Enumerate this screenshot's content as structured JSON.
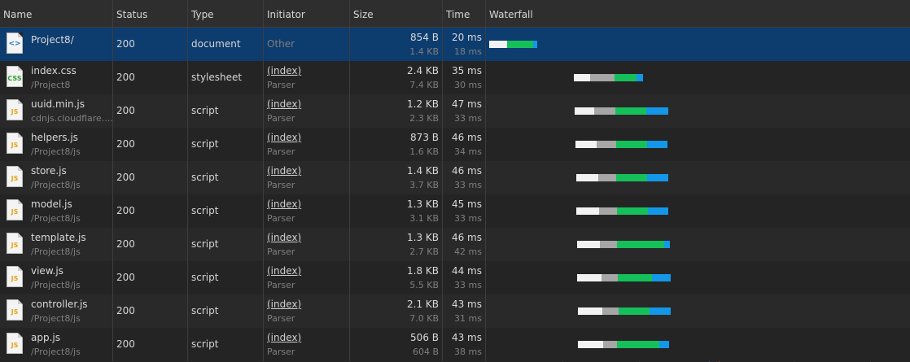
{
  "columns": {
    "name": "Name",
    "status": "Status",
    "type": "Type",
    "initiator": "Initiator",
    "size": "Size",
    "time": "Time",
    "waterfall": "Waterfall"
  },
  "colors": {
    "selected_row": "#0d3c6e",
    "queueing": "#f2f2f2",
    "stalled": "#a6a6a6",
    "waiting": "#15c05a",
    "download": "#1497e8",
    "dom_content_loaded_line": "#1f5fb8",
    "load_line": "#b3262b"
  },
  "rows": [
    {
      "name": "Project8/",
      "path": "",
      "icon": "document-icon",
      "status": "200",
      "type": "document",
      "initiator": "Other",
      "initiator_sub": "",
      "size": "854 B",
      "size_sub": "1.4 KB",
      "time": "20 ms",
      "time_sub": "18 ms",
      "selected": true
    },
    {
      "name": "index.css",
      "path": "/Project8",
      "icon": "css-file-icon",
      "status": "200",
      "type": "stylesheet",
      "initiator": "(index)",
      "initiator_sub": "Parser",
      "size": "2.4 KB",
      "size_sub": "7.4 KB",
      "time": "35 ms",
      "time_sub": "30 ms",
      "selected": false
    },
    {
      "name": "uuid.min.js",
      "path": "cdnjs.cloudflare....",
      "icon": "js-file-icon",
      "status": "200",
      "type": "script",
      "initiator": "(index)",
      "initiator_sub": "Parser",
      "size": "1.2 KB",
      "size_sub": "2.3 KB",
      "time": "47 ms",
      "time_sub": "33 ms",
      "selected": false
    },
    {
      "name": "helpers.js",
      "path": "/Project8/js",
      "icon": "js-file-icon",
      "status": "200",
      "type": "script",
      "initiator": "(index)",
      "initiator_sub": "Parser",
      "size": "873 B",
      "size_sub": "1.6 KB",
      "time": "46 ms",
      "time_sub": "34 ms",
      "selected": false
    },
    {
      "name": "store.js",
      "path": "/Project8/js",
      "icon": "js-file-icon",
      "status": "200",
      "type": "script",
      "initiator": "(index)",
      "initiator_sub": "Parser",
      "size": "1.4 KB",
      "size_sub": "3.7 KB",
      "time": "46 ms",
      "time_sub": "33 ms",
      "selected": false
    },
    {
      "name": "model.js",
      "path": "/Project8/js",
      "icon": "js-file-icon",
      "status": "200",
      "type": "script",
      "initiator": "(index)",
      "initiator_sub": "Parser",
      "size": "1.3 KB",
      "size_sub": "3.1 KB",
      "time": "45 ms",
      "time_sub": "33 ms",
      "selected": false
    },
    {
      "name": "template.js",
      "path": "/Project8/js",
      "icon": "js-file-icon",
      "status": "200",
      "type": "script",
      "initiator": "(index)",
      "initiator_sub": "Parser",
      "size": "1.3 KB",
      "size_sub": "2.7 KB",
      "time": "46 ms",
      "time_sub": "42 ms",
      "selected": false
    },
    {
      "name": "view.js",
      "path": "/Project8/js",
      "icon": "js-file-icon",
      "status": "200",
      "type": "script",
      "initiator": "(index)",
      "initiator_sub": "Parser",
      "size": "1.8 KB",
      "size_sub": "5.5 KB",
      "time": "44 ms",
      "time_sub": "33 ms",
      "selected": false
    },
    {
      "name": "controller.js",
      "path": "/Project8/js",
      "icon": "js-file-icon",
      "status": "200",
      "type": "script",
      "initiator": "(index)",
      "initiator_sub": "Parser",
      "size": "2.1 KB",
      "size_sub": "7.0 KB",
      "time": "43 ms",
      "time_sub": "31 ms",
      "selected": false
    },
    {
      "name": "app.js",
      "path": "/Project8/js",
      "icon": "js-file-icon",
      "status": "200",
      "type": "script",
      "initiator": "(index)",
      "initiator_sub": "Parser",
      "size": "506 B",
      "size_sub": "604 B",
      "time": "43 ms",
      "time_sub": "38 ms",
      "selected": false
    }
  ]
}
